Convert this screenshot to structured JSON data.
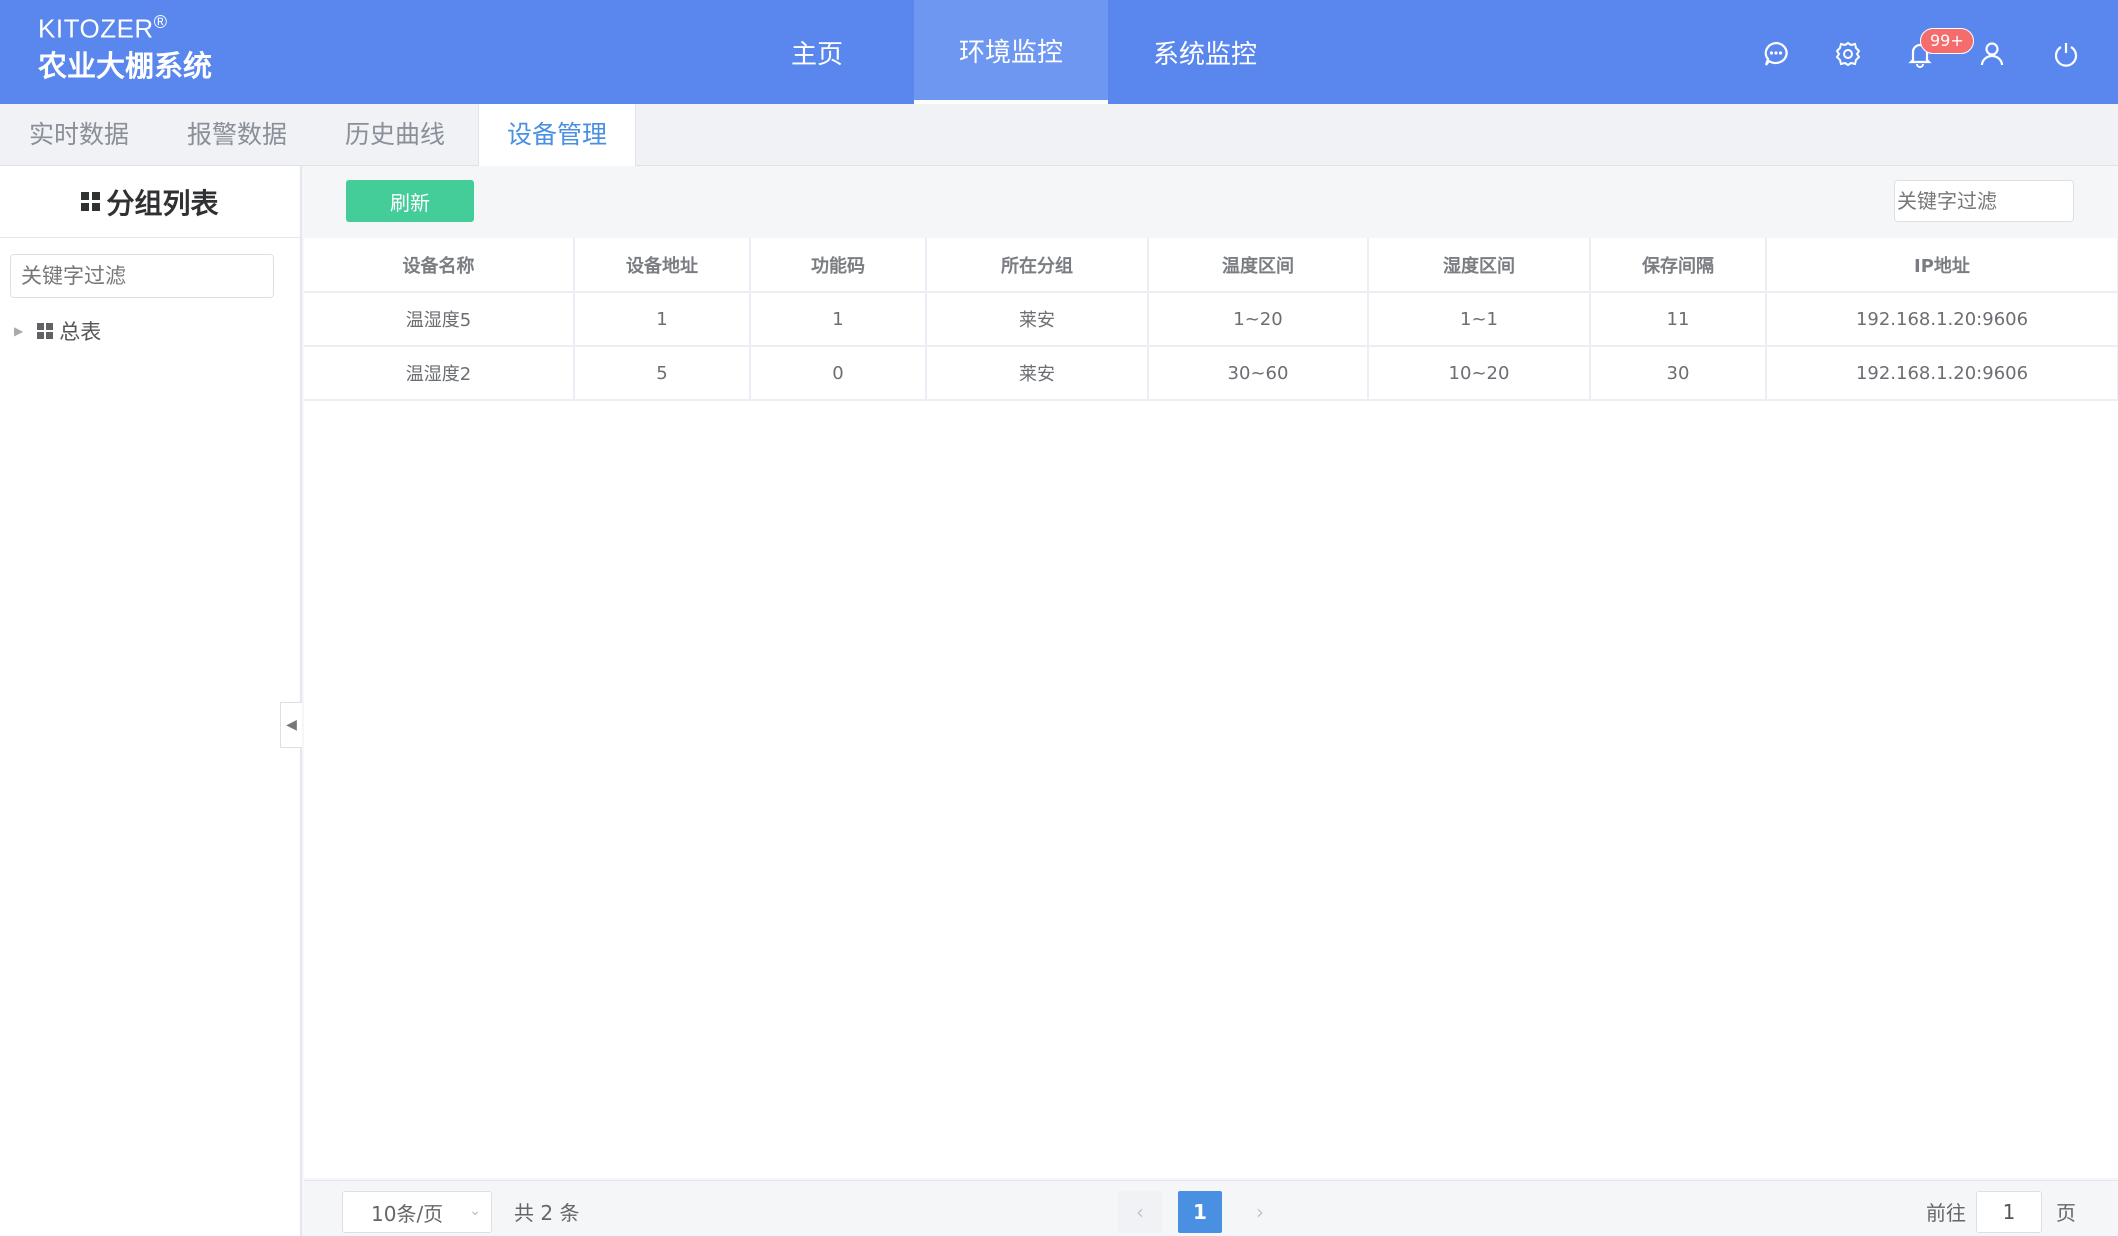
{
  "brand": {
    "name": "KITOZER",
    "reg": "®",
    "subtitle": "农业大棚系统"
  },
  "nav": [
    {
      "label": "主页"
    },
    {
      "label": "环境监控"
    },
    {
      "label": "系统监控"
    }
  ],
  "header_icons": [
    "chat-icon",
    "gear-icon",
    "bell-icon",
    "user-icon",
    "power-icon"
  ],
  "notification_badge": "99+",
  "subtabs": [
    {
      "label": "实时数据"
    },
    {
      "label": "报警数据"
    },
    {
      "label": "历史曲线"
    },
    {
      "label": "设备管理"
    }
  ],
  "sidebar": {
    "title": "分组列表",
    "search_placeholder": "关键字过滤",
    "tree_root": "总表"
  },
  "toolbar": {
    "refresh_label": "刷新",
    "filter_placeholder": "关键字过滤"
  },
  "table": {
    "columns": [
      "设备名称",
      "设备地址",
      "功能码",
      "所在分组",
      "温度区间",
      "湿度区间",
      "保存间隔",
      "IP地址"
    ],
    "rows": [
      [
        "温湿度5",
        "1",
        "1",
        "莱安",
        "1~20",
        "1~1",
        "11",
        "192.168.1.20:9606"
      ],
      [
        "温湿度2",
        "5",
        "0",
        "莱安",
        "30~60",
        "10~20",
        "30",
        "192.168.1.20:9606"
      ]
    ]
  },
  "pagination": {
    "page_size": "10条/页",
    "total": "共 2 条",
    "current_page": "1",
    "goto_prefix": "前往",
    "goto_value": "1",
    "goto_suffix": "页"
  },
  "colors": {
    "header": "#5a87ee",
    "accent": "#4a90e2",
    "refresh": "#44cc99",
    "badge": "#f56c6c"
  }
}
